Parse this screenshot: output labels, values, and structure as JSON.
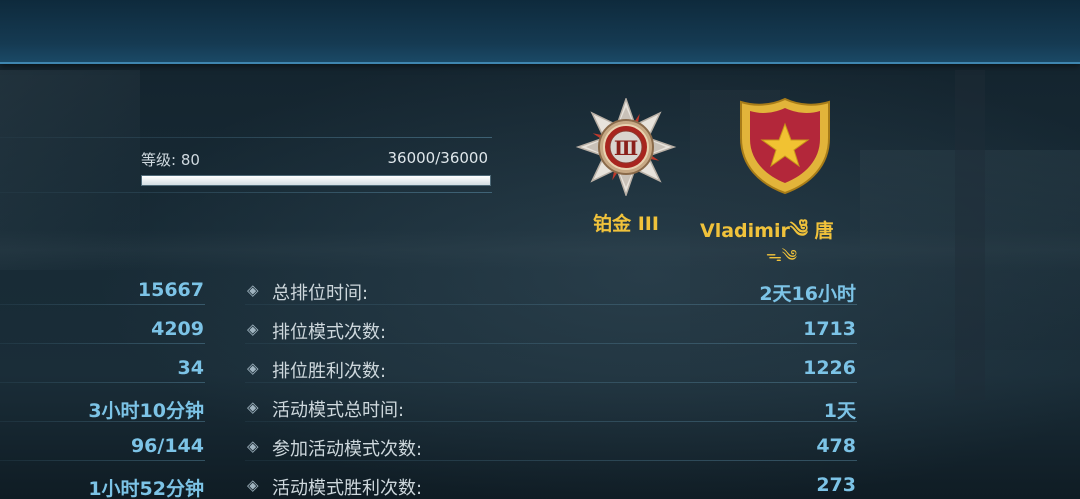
{
  "level": {
    "label": "等级: 80",
    "progress_text": "36000/36000",
    "progress_fraction": 1.0
  },
  "rank": {
    "badge_numeral": "Ⅲ",
    "name": "铂金 III",
    "icon": "platinum-rank-medal-icon"
  },
  "player": {
    "name": "Vladimir༄ᩚ 唐",
    "decoration": "ᯓ༄",
    "emblem_icon": "red-shield-gold-star-icon"
  },
  "left_stats": [
    "15667",
    "4209",
    "34",
    "3小时10分钟",
    "96/144",
    "1小时52分钟"
  ],
  "right_stats": [
    {
      "label": "总排位时间:",
      "value": "2天16小时"
    },
    {
      "label": "排位模式次数:",
      "value": "1713"
    },
    {
      "label": "排位胜利次数:",
      "value": "1226"
    },
    {
      "label": "活动模式总时间:",
      "value": "1天"
    },
    {
      "label": "参加活动模式次数:",
      "value": "478"
    },
    {
      "label": "活动模式胜利次数:",
      "value": "273"
    }
  ],
  "bullet_glyph": "◈",
  "colors": {
    "accent_gold": "#f0c23b",
    "stat_value_blue": "#7cc3e6",
    "top_bar": "#153a52"
  }
}
